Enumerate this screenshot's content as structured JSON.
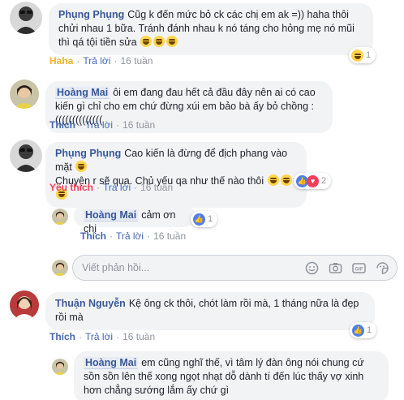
{
  "comments": [
    {
      "author": "Phụng Phụng",
      "text": "Cũg k đến mức bỏ ck các chị em ak =)) haha thôi chửi nhau 1 bữa. Tránh đánh nhau k nó táng cho hỏng mẹ nó mũi thì qá tội tiền sửa",
      "reaction_label": "Haha",
      "reply_label": "Trả lời",
      "time": "16 tuần",
      "reaction_count": "1"
    },
    {
      "author": "Hoàng Mai",
      "text": "ôi em đang đau hết cả đầu đây nên ai có cao kiến gì chỉ cho em chứ đừng xúi em bảo bà ấy bỏ chồng :((((((((((((((",
      "reaction_label": "Thích",
      "reply_label": "Trả lời",
      "time": "16 tuần"
    },
    {
      "author": "Phụng Phụng",
      "text": "Cao kiến là đừng để địch phang vào mặt",
      "text2": "Chuyện r sẽ qua. Chủ yếu qa như thế nào thôi",
      "reaction_label": "Yêu thích",
      "reply_label": "Trả lời",
      "time": "16 tuần",
      "reaction_count": "2"
    },
    {
      "author": "Hoàng Mai",
      "text": "cảm ơn chị",
      "reaction_label": "Thích",
      "reply_label": "Trả lời",
      "time": "16 tuần",
      "reaction_count": "1"
    },
    {
      "author": "Thuận Nguyễn",
      "text": "Kệ ông ck thôi, chót làm rồi mà, 1 tháng nữa là đẹp rồi mà",
      "reaction_label": "Thích",
      "reply_label": "Trả lời",
      "time": "16 tuần",
      "reaction_count": "1"
    },
    {
      "author": "Hoàng Mai",
      "text": "em cũng nghĩ thế, vì tâm lý đàn ông nói chung cứ sồn sồn lên thế xong ngọt nhạt dỗ dành tí đến lúc thấy vợ xinh hơn chẳng sướng lắm ấy chứ gì"
    }
  ],
  "reply_box": {
    "placeholder": "Viết phản hồi...",
    "icons": [
      "emoji-icon",
      "camera-icon",
      "gif-icon",
      "sticker-icon"
    ]
  },
  "colors": {
    "name": "#385898",
    "like": "#4267b2",
    "haha": "#f7b125",
    "love": "#f33e58",
    "bubble": "#f2f3f5"
  }
}
